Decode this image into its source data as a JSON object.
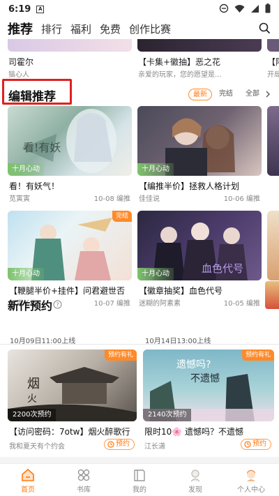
{
  "status": {
    "time": "6:19",
    "notif": "A"
  },
  "nav": {
    "tabs": [
      "推荐",
      "排行",
      "福利",
      "免费",
      "创作比赛"
    ],
    "active": "推荐"
  },
  "prev_row": {
    "items": [
      {
        "name": "司霍尔",
        "sub": "猫心人"
      },
      {
        "name": "【卡集+徽抽】恶之花",
        "sub": "亲爱的玩家，您的愿望是..."
      },
      {
        "name": "【阿",
        "sub": "开局"
      }
    ]
  },
  "editor_pick": {
    "title": "编辑推荐",
    "filters": [
      "最新",
      "完结",
      "全部"
    ],
    "active_filter": "最新",
    "cards": [
      {
        "name": "看！有妖气！",
        "author": "苋寅寅",
        "meta": "10-08 编推",
        "badge": "十月心动",
        "tag": ""
      },
      {
        "name": "【编推半价】拯救人格计划",
        "author": "佳佳说",
        "meta": "10-06 编推",
        "badge": "十月心动",
        "tag": ""
      },
      {
        "name": "【鞭腿半价+挂件】问君避世否",
        "author": "阿青丫头",
        "meta": "10-07 编推",
        "badge": "十月心动",
        "tag": "完结"
      },
      {
        "name": "【徽章抽奖】血色代号",
        "author": "迷糊的阿素素",
        "meta": "10-05 编推",
        "badge": "十月心动",
        "tag": ""
      }
    ]
  },
  "new_works": {
    "title": "新作预约",
    "items": [
      {
        "date": "10月09日11:00上线",
        "name": "【访问密码：7otw】烟火醉歌行",
        "author": "我和夏天有个约会",
        "count": "2200次预约",
        "tag": "预约有礼",
        "reserve": "预约"
      },
      {
        "date": "10月14日13:00上线",
        "name": "限时10🌸 遗憾吗？不遗憾",
        "author": "江长潇",
        "count": "2140次预约",
        "tag": "预约有礼",
        "reserve": "预约"
      }
    ]
  },
  "bottom_nav": {
    "items": [
      "首页",
      "书库",
      "我的",
      "发现",
      "个人中心"
    ],
    "active": "首页"
  },
  "colors": {
    "accent": "#ff7a10",
    "highlight_box": "#e02020",
    "badge_green": "#7cc36b"
  }
}
